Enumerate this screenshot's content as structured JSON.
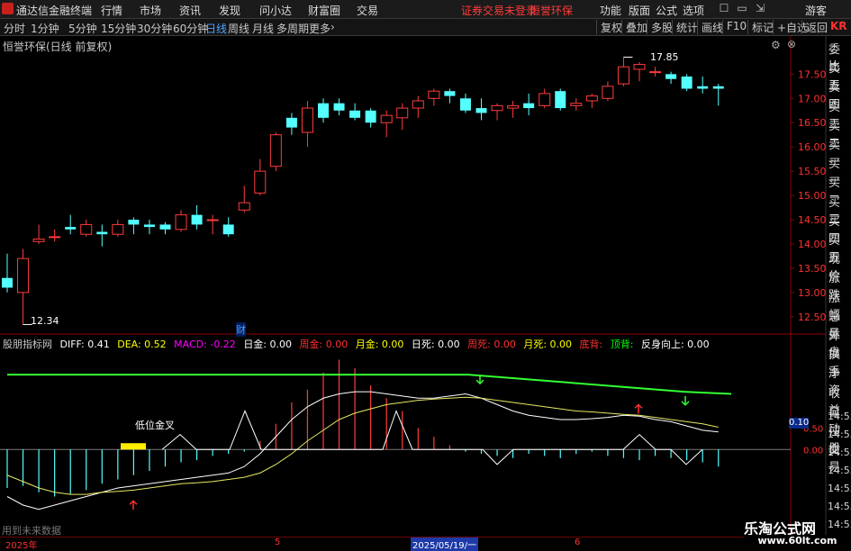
{
  "app_title": "通达信金融终端",
  "menu": {
    "items": [
      "行情",
      "市场",
      "资讯",
      "发现",
      "问小达",
      "财富圈",
      "交易"
    ],
    "warning": "证券交易未登录",
    "stock_name": "恒誉环保",
    "right_items": [
      "功能",
      "版面",
      "公式",
      "选项"
    ],
    "guest": "游客"
  },
  "periods": [
    "分时",
    "1分钟",
    "5分钟",
    "15分钟",
    "30分钟",
    "60分钟",
    "日线",
    "周线",
    "月线",
    "多周期",
    "更多"
  ],
  "active_period": "日线",
  "toolbar": [
    "复权",
    "叠加",
    "多股",
    "统计",
    "画线",
    "F10",
    "标记",
    "+自选",
    "返回"
  ],
  "kr_label": "KR",
  "panel_title": "恒誉环保(日线 前复权)",
  "price_axis": [
    "17.50",
    "17.00",
    "16.50",
    "16.00",
    "15.50",
    "15.00",
    "14.50",
    "14.00",
    "13.50",
    "13.00",
    "12.50"
  ],
  "high_label": "17.85",
  "low_label": "12.34",
  "cai_label": "财",
  "side_labels": [
    "委比",
    "卖五",
    "卖四",
    "卖三",
    "卖二",
    "卖一",
    "买一",
    "买二",
    "买三",
    "买四",
    "买五",
    "现价",
    "涨跌",
    "涨幅",
    "总量",
    "外盘",
    "换手",
    "净资",
    "收益",
    "自动",
    "注册",
    "交易"
  ],
  "indicator": {
    "name": "股朋指标网",
    "diff": "DIFF: 0.41",
    "dea": "DEA: 0.52",
    "macd": "MACD: -0.22",
    "rijin": "日金: 0.00",
    "zhoujin": "周金: 0.00",
    "yuejin": "月金: 0.00",
    "risi": "日死: 0.00",
    "zhousi": "周死: 0.00",
    "yuesi": "月死: 0.00",
    "dibei": "底背:",
    "dingbei": "顶背:",
    "fanshen": "反身向上: 0.00"
  },
  "ind_axis": [
    "0.50",
    "0.00"
  ],
  "ind_value_box": "0.10",
  "golden_cross_label": "低位金叉",
  "time_labels": [
    "14:55",
    "14:55",
    "14:55",
    "14:55",
    "14:55",
    "14:55",
    "14:55"
  ],
  "no_data_text": "用到未来数据",
  "dates": {
    "start": "2025年",
    "mid": "5",
    "cursor": "2025/05/19/一",
    "end": "6"
  },
  "watermark": "乐淘公式网",
  "watermark_url": "www.60lt.com",
  "chart_data": {
    "type": "candlestick",
    "ylim": [
      12.2,
      18.1
    ],
    "candles": [
      {
        "o": 13.3,
        "c": 13.1,
        "h": 13.8,
        "l": 13.0
      },
      {
        "o": 13.0,
        "c": 13.7,
        "h": 13.9,
        "l": 12.34
      },
      {
        "o": 14.05,
        "c": 14.1,
        "h": 14.4,
        "l": 14.0
      },
      {
        "o": 14.15,
        "c": 14.15,
        "h": 14.3,
        "l": 14.05
      },
      {
        "o": 14.35,
        "c": 14.3,
        "h": 14.6,
        "l": 14.2
      },
      {
        "o": 14.2,
        "c": 14.4,
        "h": 14.5,
        "l": 14.15
      },
      {
        "o": 14.25,
        "c": 14.2,
        "h": 14.4,
        "l": 13.95
      },
      {
        "o": 14.2,
        "c": 14.4,
        "h": 14.5,
        "l": 14.15
      },
      {
        "o": 14.5,
        "c": 14.4,
        "h": 14.55,
        "l": 14.2
      },
      {
        "o": 14.4,
        "c": 14.35,
        "h": 14.5,
        "l": 14.2
      },
      {
        "o": 14.4,
        "c": 14.3,
        "h": 14.45,
        "l": 14.2
      },
      {
        "o": 14.3,
        "c": 14.6,
        "h": 14.7,
        "l": 14.25
      },
      {
        "o": 14.6,
        "c": 14.4,
        "h": 14.8,
        "l": 14.3
      },
      {
        "o": 14.5,
        "c": 14.5,
        "h": 14.6,
        "l": 14.2
      },
      {
        "o": 14.4,
        "c": 14.2,
        "h": 14.55,
        "l": 14.15
      },
      {
        "o": 14.7,
        "c": 14.85,
        "h": 15.2,
        "l": 14.65
      },
      {
        "o": 15.05,
        "c": 15.5,
        "h": 15.75,
        "l": 15.0
      },
      {
        "o": 15.6,
        "c": 16.25,
        "h": 16.3,
        "l": 15.5
      },
      {
        "o": 16.6,
        "c": 16.4,
        "h": 16.7,
        "l": 16.25
      },
      {
        "o": 16.3,
        "c": 16.8,
        "h": 16.95,
        "l": 16.0
      },
      {
        "o": 16.9,
        "c": 16.6,
        "h": 17.0,
        "l": 16.5
      },
      {
        "o": 16.9,
        "c": 16.75,
        "h": 17.0,
        "l": 16.65
      },
      {
        "o": 16.75,
        "c": 16.6,
        "h": 16.9,
        "l": 16.55
      },
      {
        "o": 16.75,
        "c": 16.5,
        "h": 16.8,
        "l": 16.4
      },
      {
        "o": 16.5,
        "c": 16.65,
        "h": 16.75,
        "l": 16.2
      },
      {
        "o": 16.6,
        "c": 16.8,
        "h": 16.9,
        "l": 16.35
      },
      {
        "o": 16.8,
        "c": 16.95,
        "h": 17.05,
        "l": 16.6
      },
      {
        "o": 17.0,
        "c": 17.15,
        "h": 17.2,
        "l": 16.85
      },
      {
        "o": 17.15,
        "c": 17.05,
        "h": 17.2,
        "l": 16.9
      },
      {
        "o": 17.0,
        "c": 16.75,
        "h": 17.1,
        "l": 16.7
      },
      {
        "o": 16.8,
        "c": 16.7,
        "h": 17.0,
        "l": 16.55
      },
      {
        "o": 16.75,
        "c": 16.85,
        "h": 16.9,
        "l": 16.55
      },
      {
        "o": 16.8,
        "c": 16.85,
        "h": 16.95,
        "l": 16.6
      },
      {
        "o": 16.9,
        "c": 16.8,
        "h": 17.1,
        "l": 16.65
      },
      {
        "o": 16.85,
        "c": 17.1,
        "h": 17.2,
        "l": 16.8
      },
      {
        "o": 17.15,
        "c": 16.8,
        "h": 17.2,
        "l": 16.75
      },
      {
        "o": 16.85,
        "c": 16.9,
        "h": 17.0,
        "l": 16.75
      },
      {
        "o": 16.95,
        "c": 17.05,
        "h": 17.1,
        "l": 16.8
      },
      {
        "o": 17.0,
        "c": 17.25,
        "h": 17.35,
        "l": 16.95
      },
      {
        "o": 17.3,
        "c": 17.65,
        "h": 17.85,
        "l": 17.25
      },
      {
        "o": 17.6,
        "c": 17.7,
        "h": 17.75,
        "l": 17.35
      },
      {
        "o": 17.55,
        "c": 17.55,
        "h": 17.65,
        "l": 17.45
      },
      {
        "o": 17.5,
        "c": 17.4,
        "h": 17.55,
        "l": 17.3
      },
      {
        "o": 17.45,
        "c": 17.2,
        "h": 17.5,
        "l": 17.15
      },
      {
        "o": 17.25,
        "c": 17.2,
        "h": 17.45,
        "l": 17.1
      },
      {
        "o": 17.25,
        "c": 17.2,
        "h": 17.3,
        "l": 16.85
      }
    ],
    "macd_bars": [
      -0.9,
      -0.85,
      -1.0,
      -1.1,
      -1.05,
      -0.95,
      -0.8,
      -0.7,
      -0.6,
      -0.5,
      -0.4,
      -0.3,
      -0.25,
      -0.15,
      -0.1,
      -0.05,
      0.2,
      0.6,
      1.1,
      1.4,
      1.8,
      2.1,
      1.9,
      1.5,
      1.2,
      0.9,
      0.5,
      0.3,
      0.1,
      -0.05,
      -0.1,
      -0.15,
      -0.2,
      -0.1,
      -0.15,
      -0.2,
      -0.1,
      -0.05,
      -0.15,
      -0.2,
      -0.25,
      -0.15,
      -0.2,
      -0.25,
      -0.3,
      -0.4
    ],
    "diff_line": [
      -1.1,
      -1.3,
      -1.4,
      -1.3,
      -1.2,
      -1.1,
      -1.0,
      -0.9,
      -0.85,
      -0.8,
      -0.75,
      -0.7,
      -0.65,
      -0.6,
      -0.55,
      -0.4,
      -0.1,
      0.3,
      0.7,
      1.0,
      1.2,
      1.3,
      1.35,
      1.35,
      1.3,
      1.25,
      1.2,
      1.2,
      1.25,
      1.3,
      1.2,
      1.05,
      0.9,
      0.8,
      0.75,
      0.7,
      0.7,
      0.72,
      0.75,
      0.8,
      0.78,
      0.7,
      0.65,
      0.55,
      0.45,
      0.41
    ],
    "dea_line": [
      -0.6,
      -0.75,
      -0.9,
      -1.0,
      -1.05,
      -1.05,
      -1.0,
      -0.98,
      -0.95,
      -0.9,
      -0.85,
      -0.8,
      -0.78,
      -0.75,
      -0.7,
      -0.65,
      -0.55,
      -0.35,
      -0.1,
      0.2,
      0.45,
      0.7,
      0.85,
      0.95,
      1.05,
      1.1,
      1.15,
      1.18,
      1.2,
      1.22,
      1.2,
      1.15,
      1.1,
      1.05,
      1.0,
      0.95,
      0.9,
      0.88,
      0.85,
      0.82,
      0.8,
      0.75,
      0.7,
      0.65,
      0.6,
      0.52
    ],
    "ind_ylim": [
      -1.7,
      2.3
    ]
  }
}
